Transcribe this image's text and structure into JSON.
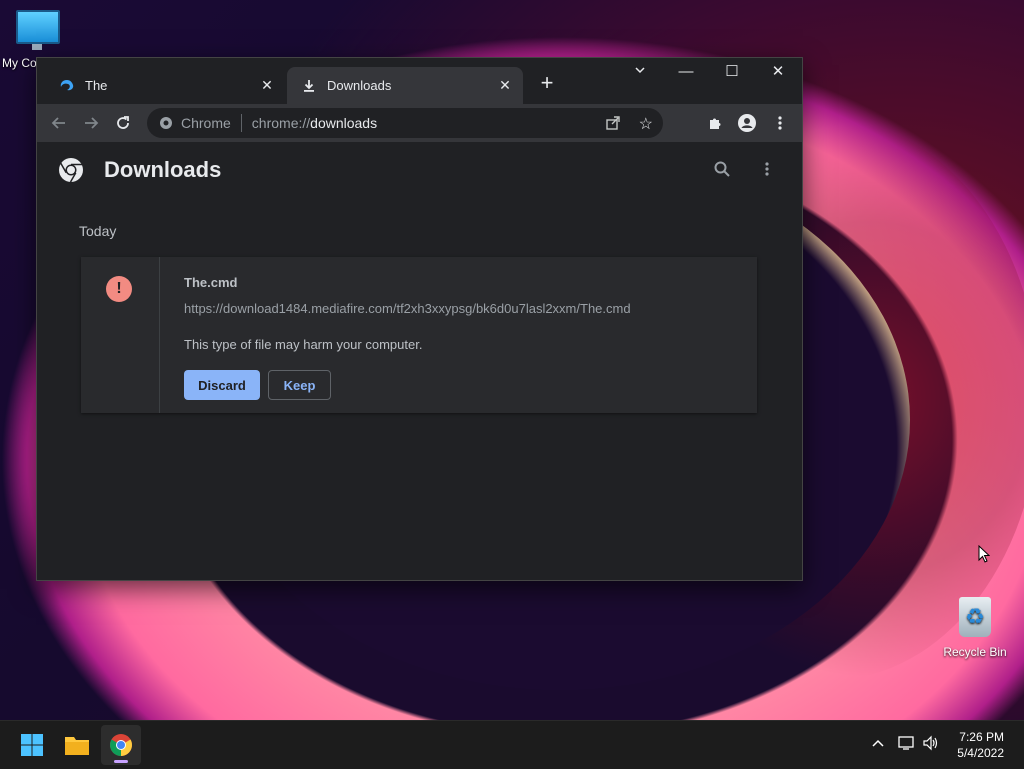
{
  "desktop": {
    "icons": [
      {
        "label": "My Co",
        "icon": "computer-icon"
      },
      {
        "label": "Recycle Bin",
        "icon": "recycle-bin-icon"
      }
    ]
  },
  "browser": {
    "tabs": [
      {
        "label": "The",
        "icon": "edge-favicon",
        "active": false
      },
      {
        "label": "Downloads",
        "icon": "download-icon",
        "active": true
      }
    ],
    "omnibox": {
      "chip": "Chrome",
      "scheme": "chrome://",
      "path": "downloads"
    },
    "page": {
      "title": "Downloads",
      "date_group": "Today",
      "item": {
        "filename": "The.cmd",
        "url": "https://download1484.mediafire.com/tf2xh3xxypsg/bk6d0u7lasl2xxm/The.cmd",
        "warning": "This type of file may harm your computer.",
        "discard_label": "Discard",
        "keep_label": "Keep"
      }
    }
  },
  "taskbar": {
    "time": "7:26 PM",
    "date": "5/4/2022"
  },
  "colors": {
    "accent": "#8ab4f8",
    "warning": "#f28b82"
  }
}
